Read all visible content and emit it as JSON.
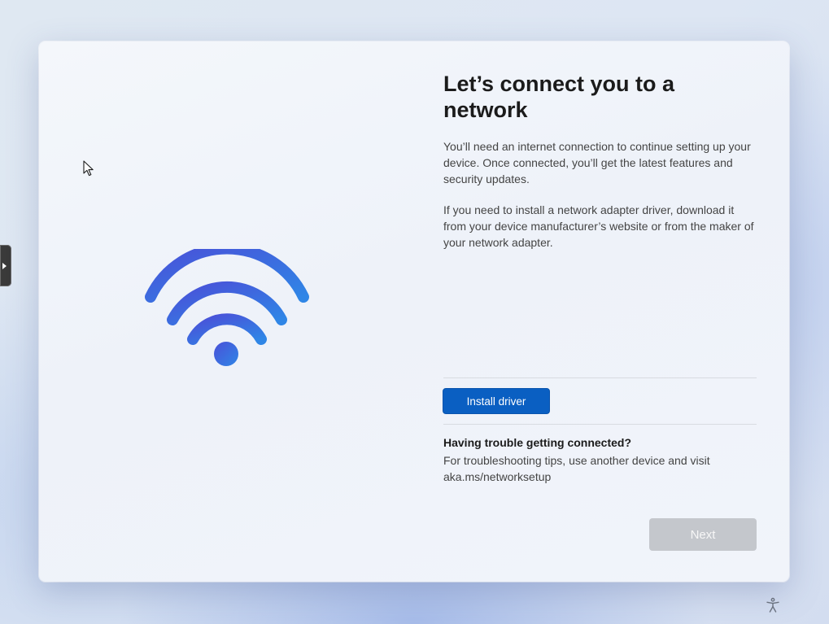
{
  "dialog": {
    "title": "Let’s connect you to a network",
    "paragraph1": "You’ll need an internet connection to continue setting up your device. Once connected, you’ll get the latest features and security updates.",
    "paragraph2": "If you need to install a network adapter driver, download it from your device manufacturer’s website or from the maker of your network adapter.",
    "install_button": "Install driver",
    "trouble_title": "Having trouble getting connected?",
    "trouble_text": "For troubleshooting tips, use another device and visit aka.ms/networksetup",
    "next_button": "Next",
    "next_enabled": false
  },
  "icons": {
    "illustration": "wifi-icon",
    "side_handle": "chevron-right-icon",
    "accessibility": "accessibility-icon",
    "pointer": "mouse-cursor-icon"
  },
  "colors": {
    "accent": "#0a5fc2",
    "wifi_blue": "#3b5fe0",
    "wifi_light": "#2f8ae8",
    "disabled_button": "#c4c7cc"
  }
}
